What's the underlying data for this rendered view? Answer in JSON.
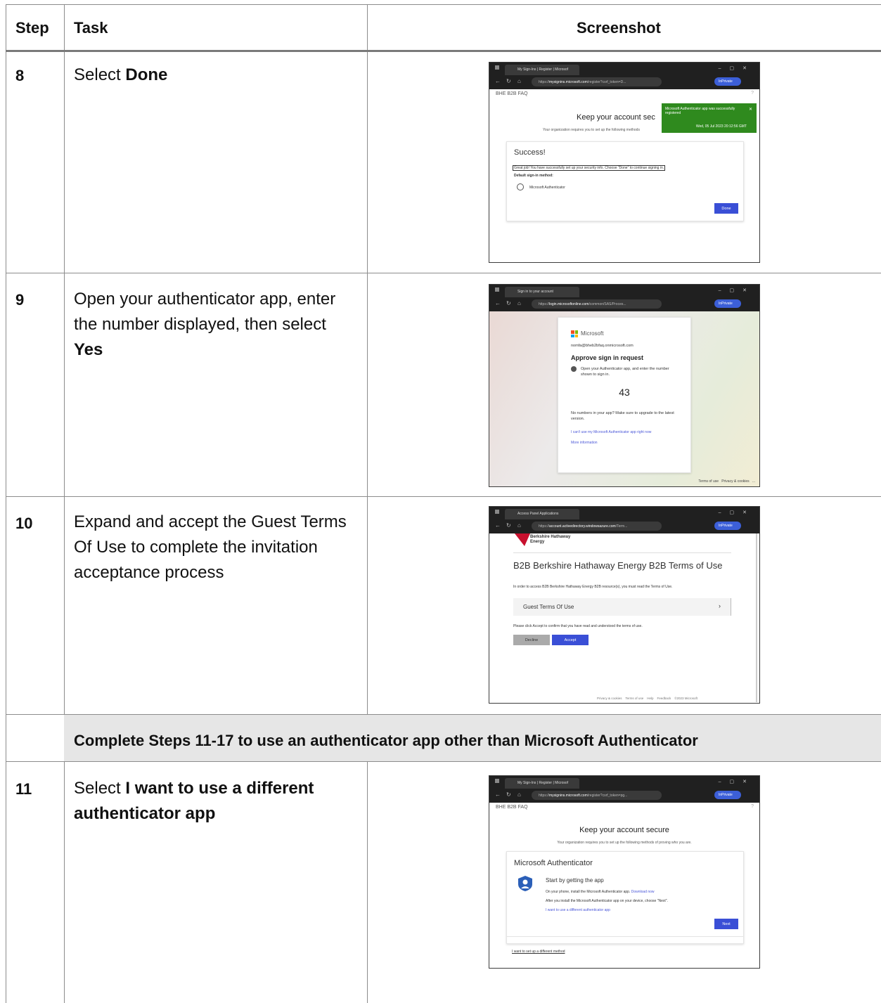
{
  "headers": {
    "step": "Step",
    "task": "Task",
    "screenshot": "Screenshot"
  },
  "rows": [
    {
      "step": "8",
      "task_pre": "Select ",
      "task_bold": "Done"
    },
    {
      "step": "9",
      "task_pre": "Open your authenticator app, enter the number displayed, then select ",
      "task_bold": "Yes"
    },
    {
      "step": "10",
      "task_pre": "Expand and accept the Guest Terms Of Use to complete the invitation acceptance process",
      "task_bold": ""
    },
    {
      "step": "11",
      "task_pre": "Select ",
      "task_bold": "I want to use a different authenticator app"
    }
  ],
  "section_note": "Complete Steps 11-17 to use an authenticator app other than Microsoft Authenticator",
  "shot8": {
    "tab": "My Sign-Ins | Register | Microsof",
    "url_host": "mysignins.microsoft.com",
    "url_prefix": "https://",
    "url_rest": "/register?csrf_token=D...",
    "inprivate": "InPrivate",
    "brand": "BHE B2B FAQ",
    "title": "Keep your account sec",
    "subtitle": "Your organization requires you to set up the following methods",
    "toast": "Microsoft Authenticator app was successfully registered",
    "toast_time": "Wed, 05 Jul 2023 20:12:56 GMT",
    "success": "Success!",
    "success_msg": "Great job! You have successfully set up your security info. Choose \"Done\" to continue signing in.",
    "default_label": "Default sign-in method:",
    "method": "Microsoft Authenticator",
    "done": "Done"
  },
  "shot9": {
    "tab": "Sign in to your account",
    "url_host": "login.microsoftonline.com",
    "url_prefix": "https://",
    "url_rest": "/common/SAS/Proces...",
    "inprivate": "InPrivate",
    "ms": "Microsoft",
    "email": "nomfa@bheb2bfaq.onmicrosoft.com",
    "heading": "Approve sign in request",
    "instruction": "Open your Authenticator app, and enter the number shown to sign in.",
    "number": "43",
    "nonumbers": "No numbers in your app? Make sure to upgrade to the latest version.",
    "cantuse": "I can't use my Microsoft Authenticator app right now",
    "moreinfo": "More information",
    "footer": "Terms of use   Privacy & cookies   ..."
  },
  "shot10": {
    "tab": "Access Panel Applications",
    "url_host": "account.activedirectory.windowsazure.com",
    "url_prefix": "https://",
    "url_rest": "/Term...",
    "inprivate": "InPrivate",
    "logo1": "Berkshire Hathaway",
    "logo2": "Energy",
    "title": "B2B Berkshire Hathaway Energy B2B Terms of Use",
    "intro": "In order to access B2B Berkshire Hathaway Energy B2B resource(s), you must read the Terms of Use.",
    "expand": "Guest Terms Of Use",
    "confirm": "Please click Accept to confirm that you have read and understood the terms of use.",
    "decline": "Decline",
    "accept": "Accept",
    "footer": "Privacy & cookies    Terms of use    Help    Feedback    ©2023 Microsoft"
  },
  "shot11": {
    "tab": "My Sign-Ins | Register | Microsof",
    "url_host": "mysignins.microsoft.com",
    "url_prefix": "https://",
    "url_rest": "/register?csrf_token=pg...",
    "inprivate": "InPrivate",
    "brand": "BHE B2B FAQ",
    "title": "Keep your account secure",
    "subtitle": "Your organization requires you to set up the following methods of proving who you are.",
    "card_title": "Microsoft Authenticator",
    "start": "Start by getting the app",
    "line1": "On your phone, install the Microsoft Authenticator app.",
    "download": "Download now",
    "line2": "After you install the Microsoft Authenticator app on your device, choose \"Next\".",
    "different_app": "I want to use a different authenticator app",
    "next": "Next",
    "different_method": "I want to set up a different method"
  },
  "colors": {
    "toast": "#2f8a1e",
    "accent": "#3a4fd6",
    "section_bg": "#e6e6e6"
  }
}
